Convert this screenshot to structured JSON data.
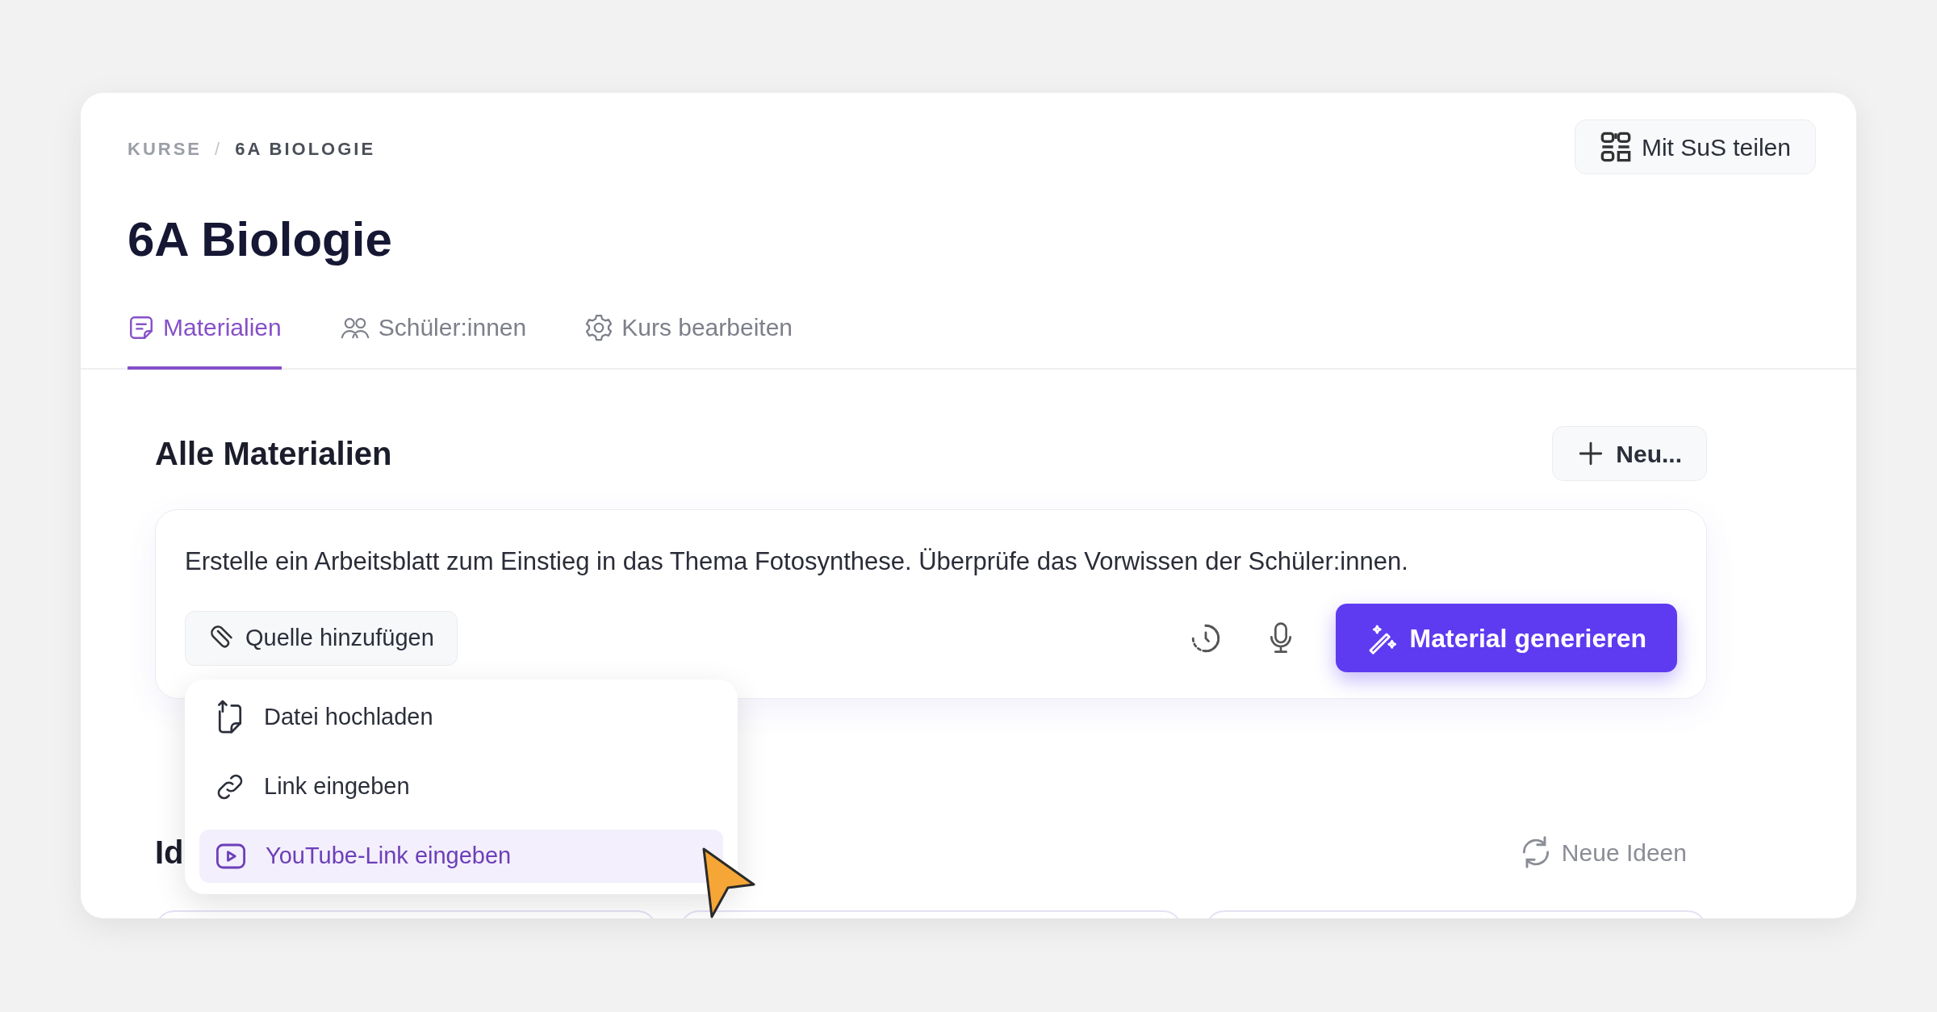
{
  "breadcrumb": [
    {
      "label": "KURSE",
      "current": false
    },
    {
      "label": "6A BIOLOGIE",
      "current": true
    }
  ],
  "breadcrumb_separator": "/",
  "title": "6A Biologie",
  "share_button": {
    "label": "Mit SuS teilen"
  },
  "tabs": [
    {
      "label": "Materialien",
      "kind": "note",
      "selected": true
    },
    {
      "label": "Schüler:innen",
      "kind": "users",
      "selected": false
    },
    {
      "label": "Kurs bearbeiten",
      "kind": "gear",
      "selected": false
    }
  ],
  "section": {
    "title": "Alle Materialien",
    "new_button": "Neu..."
  },
  "prompt": {
    "text": "Erstelle ein Arbeitsblatt zum Einstieg in das Thema Fotosynthese. Überprüfe das Vorwissen der Schüler:innen.",
    "source_button": "Quelle hinzufügen",
    "generate_button": "Material generieren"
  },
  "source_menu": [
    {
      "label": "Datei hochladen",
      "kind": "upload",
      "selected": false
    },
    {
      "label": "Link eingeben",
      "kind": "link",
      "selected": false
    },
    {
      "label": "YouTube-Link eingeben",
      "kind": "play",
      "selected": true
    }
  ],
  "ideas": {
    "title": "Id",
    "refresh_button": "Neue Ideen"
  }
}
